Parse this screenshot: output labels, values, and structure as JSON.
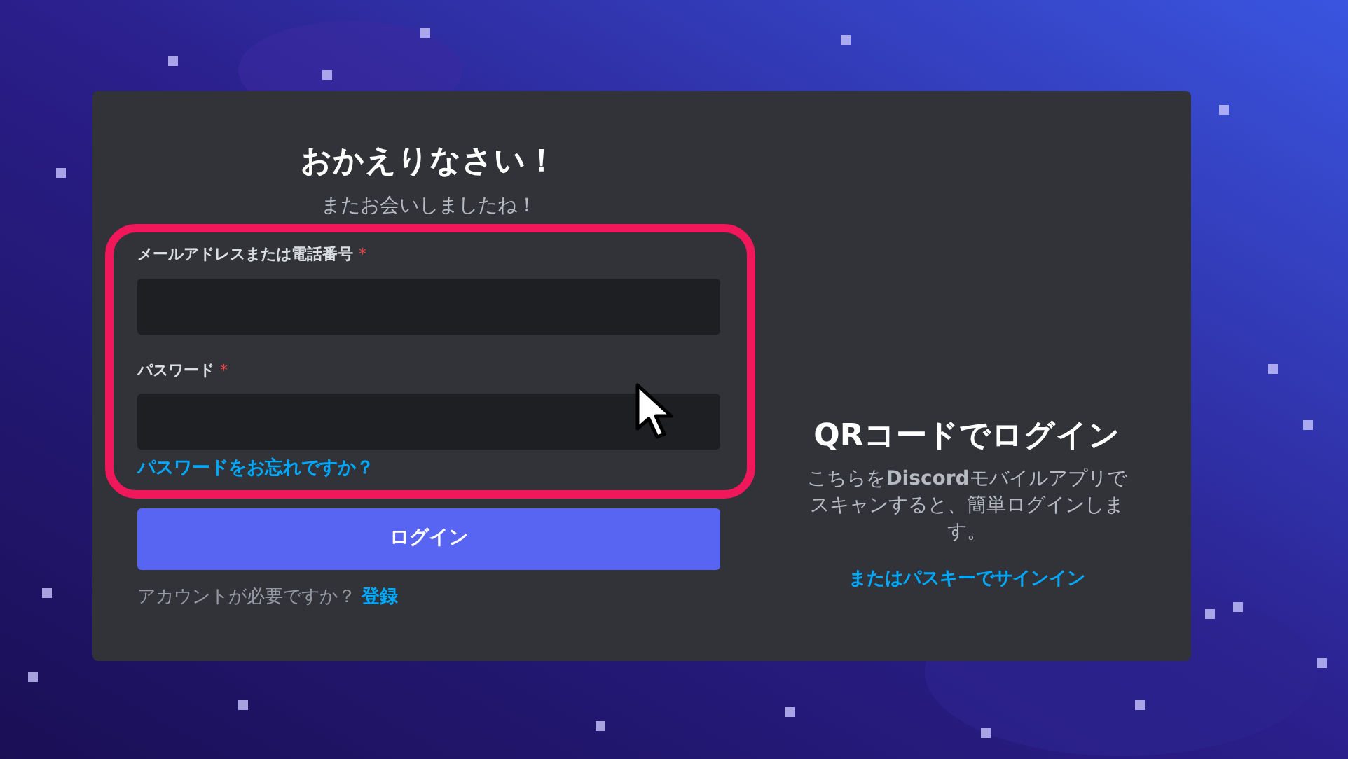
{
  "login": {
    "title": "おかえりなさい！",
    "subtitle": "またお会いしましたね！",
    "fields": [
      {
        "label": "メールアドレスまたは電話番号",
        "required_mark": "*"
      },
      {
        "label": "パスワード",
        "required_mark": "*"
      }
    ],
    "forgot_link": "パスワードをお忘れですか？",
    "login_button": "ログイン",
    "register_prompt": "アカウントが必要ですか？",
    "register_link": "登録"
  },
  "qr": {
    "title": "QRコードでログイン",
    "description": "こちらを**Discord**モバイルアプリでスキャンすると、簡単ログインします。",
    "passkey_link": "またはパスキーでサインイン"
  }
}
